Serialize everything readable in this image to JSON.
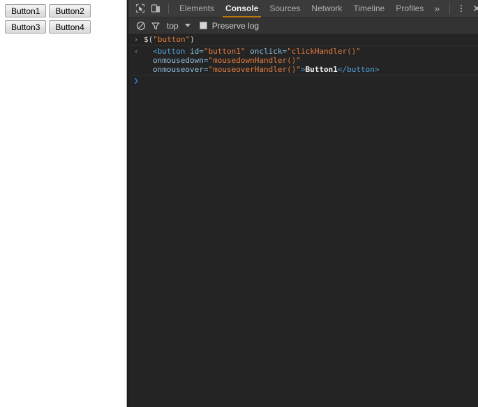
{
  "page": {
    "buttons": [
      {
        "label": "Button1",
        "name": "page-button-1"
      },
      {
        "label": "Button2",
        "name": "page-button-2"
      },
      {
        "label": "Button3",
        "name": "page-button-3"
      },
      {
        "label": "Button4",
        "name": "page-button-4"
      }
    ]
  },
  "devtools": {
    "toolbar": {
      "inspect_icon": "inspect-element-icon",
      "device_icon": "device-toolbar-icon",
      "tabs": [
        {
          "label": "Elements",
          "active": false
        },
        {
          "label": "Console",
          "active": true
        },
        {
          "label": "Sources",
          "active": false
        },
        {
          "label": "Network",
          "active": false
        },
        {
          "label": "Timeline",
          "active": false
        },
        {
          "label": "Profiles",
          "active": false
        }
      ],
      "more_tabs_label": "»",
      "menu_icon": "kebab-menu-icon",
      "close_label": "✕",
      "active_tab_accent": "#b9770e"
    },
    "filterbar": {
      "clear_icon": "clear-console-icon",
      "filter_icon": "filter-icon",
      "context_value": "top",
      "preserve_log_label": "Preserve log",
      "preserve_log_checked": false
    },
    "console": {
      "rows": [
        {
          "kind": "input",
          "gutter": "›",
          "tokens": [
            {
              "text": "$(",
              "type": "plain"
            },
            {
              "text": "\"button\"",
              "type": "string"
            },
            {
              "text": ")",
              "type": "plain"
            }
          ]
        },
        {
          "kind": "output",
          "gutter": "‹",
          "tokens": [
            {
              "text": "<button",
              "type": "tag"
            },
            {
              "text": " id=",
              "type": "attr"
            },
            {
              "text": "\"button1\"",
              "type": "value"
            },
            {
              "text": " onclick=",
              "type": "attr"
            },
            {
              "text": "\"clickHandler()\"",
              "type": "value"
            },
            {
              "text": " onmousedown=",
              "type": "attr"
            },
            {
              "text": "\"mousedownHandler()\"",
              "type": "value"
            },
            {
              "text": " onmouseover=",
              "type": "attr"
            },
            {
              "text": "\"mouseoverHandler()\"",
              "type": "value"
            },
            {
              "text": ">",
              "type": "tag"
            },
            {
              "text": "Button1",
              "type": "text"
            },
            {
              "text": "</button>",
              "type": "tag"
            }
          ]
        },
        {
          "kind": "prompt",
          "gutter": "❯",
          "tokens": []
        }
      ]
    }
  }
}
